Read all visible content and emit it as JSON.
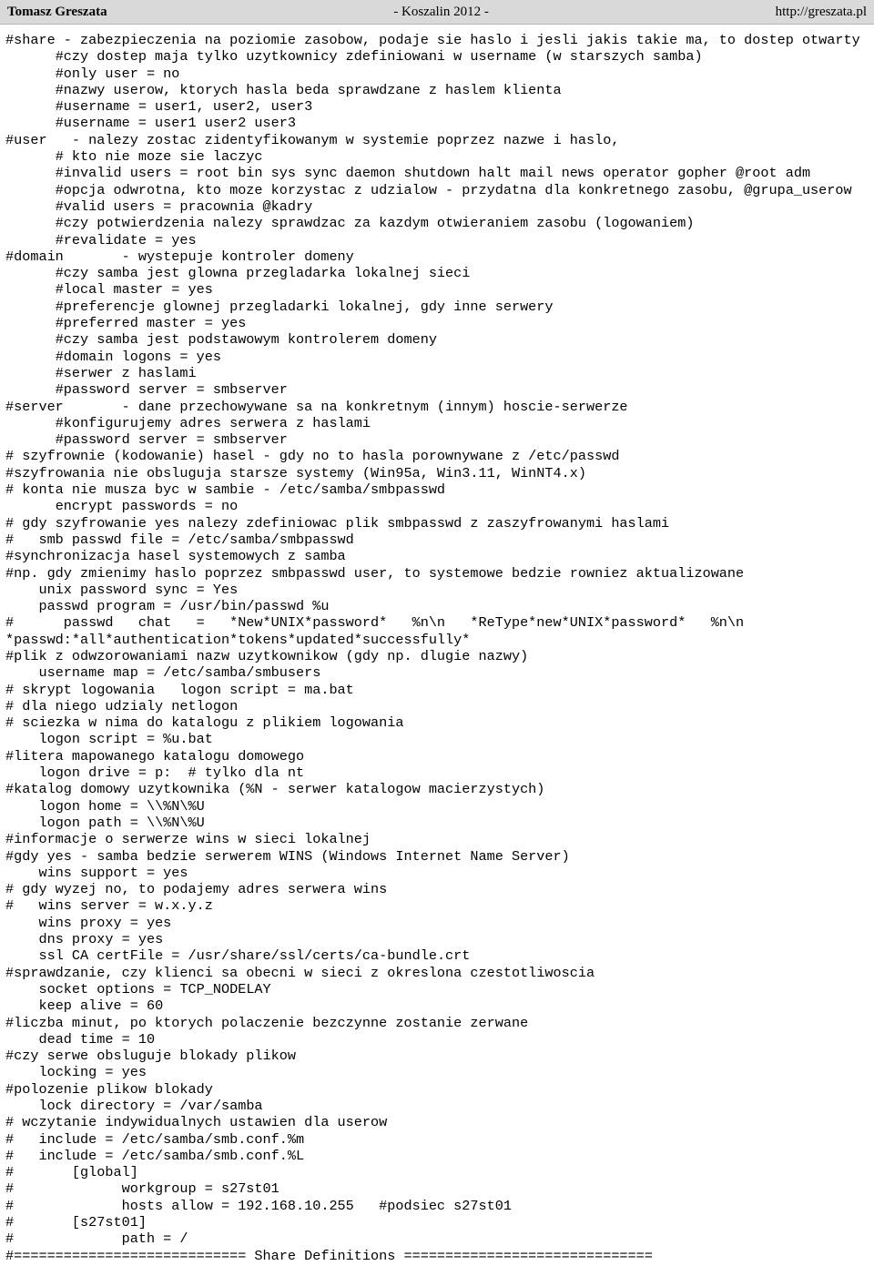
{
  "header": {
    "author": "Tomasz Greszata",
    "center_title": "- Koszalin 2012 -",
    "url": "http://greszata.pl"
  },
  "document": {
    "body_text": "#share - zabezpieczenia na poziomie zasobow, podaje sie haslo i jesli jakis takie ma, to dostep otwarty\n      #czy dostep maja tylko uzytkownicy zdefiniowani w username (w starszych samba)\n      #only user = no\n      #nazwy userow, ktorych hasla beda sprawdzane z haslem klienta\n      #username = user1, user2, user3\n      #username = user1 user2 user3\n#user   - nalezy zostac zidentyfikowanym w systemie poprzez nazwe i haslo,\n      # kto nie moze sie laczyc\n      #invalid users = root bin sys sync daemon shutdown halt mail news operator gopher @root adm\n      #opcja odwrotna, kto moze korzystac z udzialow - przydatna dla konkretnego zasobu, @grupa_userow\n      #valid users = pracownia @kadry\n      #czy potwierdzenia nalezy sprawdzac za kazdym otwieraniem zasobu (logowaniem)\n      #revalidate = yes\n#domain       - wystepuje kontroler domeny\n      #czy samba jest glowna przegladarka lokalnej sieci\n      #local master = yes\n      #preferencje glownej przegladarki lokalnej, gdy inne serwery\n      #preferred master = yes\n      #czy samba jest podstawowym kontrolerem domeny\n      #domain logons = yes\n      #serwer z haslami\n      #password server = smbserver\n#server       - dane przechowywane sa na konkretnym (innym) hoscie-serwerze\n      #konfigurujemy adres serwera z haslami\n      #password server = smbserver\n# szyfrownie (kodowanie) hasel - gdy no to hasla porownywane z /etc/passwd\n#szyfrowania nie obsluguja starsze systemy (Win95a, Win3.11, WinNT4.x)\n# konta nie musza byc w sambie - /etc/samba/smbpasswd\n      encrypt passwords = no\n# gdy szyfrowanie yes nalezy zdefiniowac plik smbpasswd z zaszyfrowanymi haslami\n#   smb passwd file = /etc/samba/smbpasswd\n#synchronizacja hasel systemowych z samba\n#np. gdy zmienimy haslo poprzez smbpasswd user, to systemowe bedzie rowniez aktualizowane\n    unix password sync = Yes\n    passwd program = /usr/bin/passwd %u\n#      passwd   chat   =   *New*UNIX*password*   %n\\n   *ReType*new*UNIX*password*   %n\\n *passwd:*all*authentication*tokens*updated*successfully*\n#plik z odwzorowaniami nazw uzytkownikow (gdy np. dlugie nazwy)\n    username map = /etc/samba/smbusers\n# skrypt logowania   logon script = ma.bat\n# dla niego udzialy netlogon\n# sciezka w nima do katalogu z plikiem logowania\n    logon script = %u.bat\n#litera mapowanego katalogu domowego\n    logon drive = p:  # tylko dla nt\n#katalog domowy uzytkownika (%N - serwer katalogow macierzystych)\n    logon home = \\\\%N\\%U\n    logon path = \\\\%N\\%U\n#informacje o serwerze wins w sieci lokalnej\n#gdy yes - samba bedzie serwerem WINS (Windows Internet Name Server)\n    wins support = yes\n# gdy wyzej no, to podajemy adres serwera wins\n#   wins server = w.x.y.z\n    wins proxy = yes\n    dns proxy = yes\n    ssl CA certFile = /usr/share/ssl/certs/ca-bundle.crt\n#sprawdzanie, czy klienci sa obecni w sieci z okreslona czestotliwoscia\n    socket options = TCP_NODELAY\n    keep alive = 60\n#liczba minut, po ktorych polaczenie bezczynne zostanie zerwane\n    dead time = 10\n#czy serwe obsluguje blokady plikow\n    locking = yes\n#polozenie plikow blokady\n    lock directory = /var/samba\n# wczytanie indywidualnych ustawien dla userow\n#   include = /etc/samba/smb.conf.%m\n#   include = /etc/samba/smb.conf.%L\n#       [global]\n#             workgroup = s27st01\n#             hosts allow = 192.168.10.255   #podsiec s27st01\n#       [s27st01]\n#             path = /\n#============================ Share Definitions =============================="
  }
}
